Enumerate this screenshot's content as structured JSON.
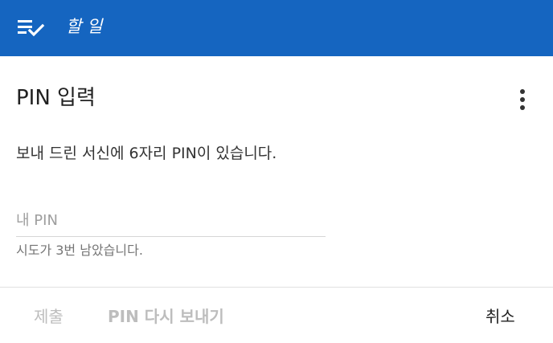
{
  "header": {
    "app_title": "할 일",
    "icon": "checklist-icon",
    "background_color": "#1565c0"
  },
  "card": {
    "title": "PIN 입력",
    "more_icon": "more-vert-icon",
    "description": "보내 드린 서신에 6자리 PIN이 있습니다.",
    "pin_input": {
      "placeholder": "내 PIN",
      "value": ""
    },
    "helper_text": "시도가 3번 남았습니다."
  },
  "actions": {
    "submit_label": "제출",
    "resend_label": "PIN 다시 보내기",
    "cancel_label": "취소"
  }
}
